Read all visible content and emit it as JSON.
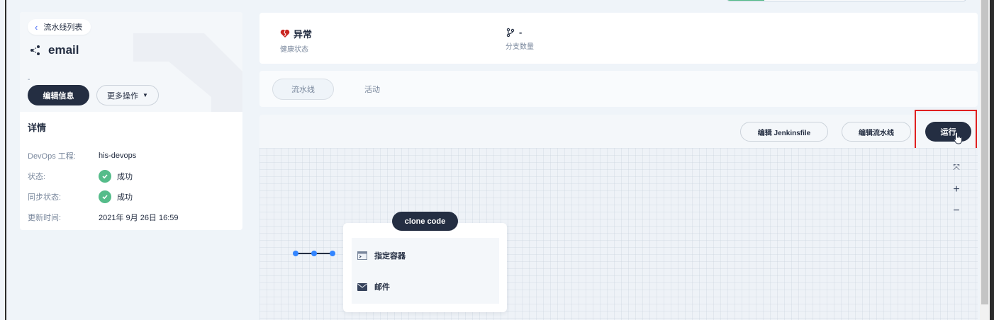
{
  "header": {
    "back_label": "流水线列表",
    "pipeline_name": "email",
    "name_sub": "-",
    "edit_info_label": "编辑信息",
    "more_actions_label": "更多操作"
  },
  "details": {
    "title": "详情",
    "rows": [
      {
        "key": "DevOps 工程:",
        "value": "his-devops"
      },
      {
        "key": "状态:",
        "value": "成功"
      },
      {
        "key": "同步状态:",
        "value": "成功"
      },
      {
        "key": "更新时间:",
        "value": "2021年 9月 26日 16:59"
      }
    ]
  },
  "stats": {
    "health_value": "异常",
    "health_label": "健康状态",
    "branch_value": "-",
    "branch_label": "分支数量"
  },
  "tabs": [
    {
      "label": "流水线",
      "active": true
    },
    {
      "label": "活动",
      "active": false
    }
  ],
  "toolbar": {
    "edit_jenkinsfile_label": "编辑 Jenkinsfile",
    "edit_pipeline_label": "编辑流水线",
    "run_label": "运行"
  },
  "canvas": {
    "zoom_controls": [
      "fit-screen-icon",
      "zoom-in-icon",
      "zoom-out-icon"
    ],
    "stage": {
      "name": "clone code",
      "steps": [
        {
          "icon": "container-icon",
          "label": "指定容器"
        },
        {
          "icon": "mail-icon",
          "label": "邮件"
        }
      ]
    }
  },
  "colors": {
    "primary_dark": "#242e42",
    "success": "#55bc8a",
    "danger": "#ca2621",
    "highlight_border": "#e02020",
    "node_blue": "#3385ff"
  }
}
